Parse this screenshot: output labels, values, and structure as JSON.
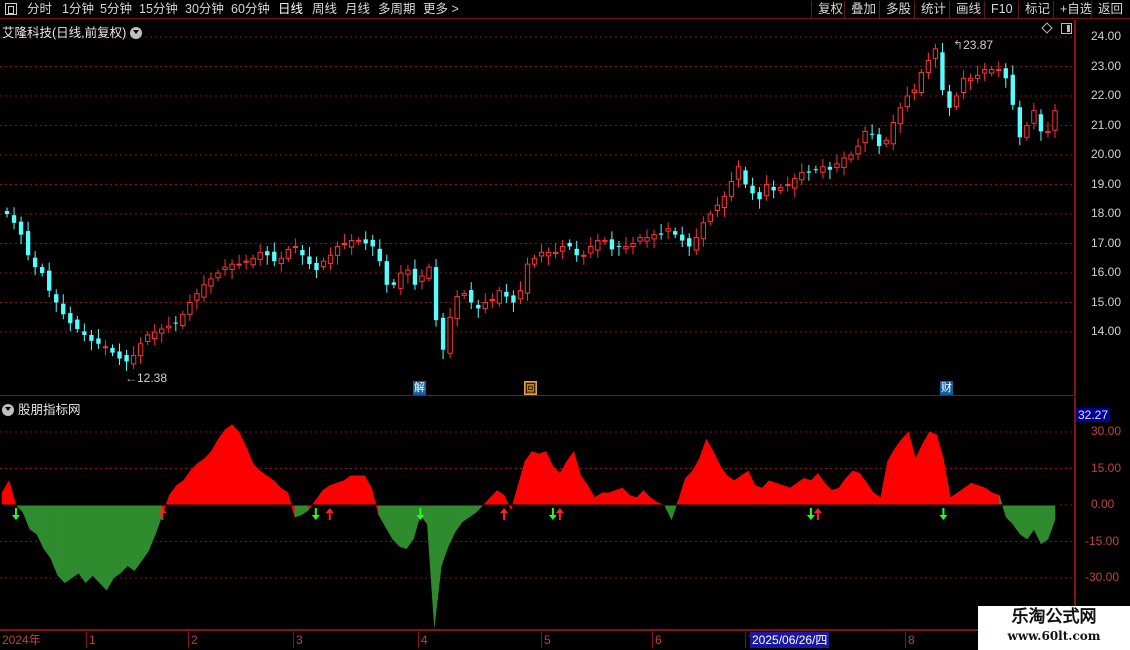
{
  "toolbar": {
    "left_items": [
      "分时",
      "1分钟",
      "5分钟",
      "15分钟",
      "30分钟",
      "60分钟",
      "日线",
      "周线",
      "月线",
      "多周期",
      "更多 >"
    ],
    "active_item": "日线",
    "right_items": [
      "复权",
      "叠加",
      "多股",
      "统计",
      "画线",
      "F10",
      "标记",
      "+自选",
      "返回"
    ]
  },
  "main_panel": {
    "title": "艾隆科技(日线,前复权)",
    "high_label": "23.87",
    "low_label": "12.38",
    "price_axis": [
      "24.00",
      "23.00",
      "22.00",
      "21.00",
      "20.00",
      "19.00",
      "18.00",
      "17.00",
      "16.00",
      "15.00",
      "14.00"
    ],
    "event_tags": [
      "解",
      "回",
      "财"
    ]
  },
  "indicator_panel": {
    "title": "股朋指标网",
    "current_value": "32.27",
    "axis": [
      "30.00",
      "15.00",
      "0.00",
      "-15.00",
      "-30.00"
    ]
  },
  "date_axis": {
    "labels": [
      "2024年",
      "1",
      "2",
      "3",
      "4",
      "5",
      "6",
      "7",
      "8"
    ],
    "cursor_date": "2025/06/26/四"
  },
  "watermark": {
    "line1": "乐淘公式网",
    "line2": "www.60lt.com"
  },
  "colors": {
    "up_candle": "#ff3232",
    "down_candle": "#54ffff",
    "indicator_positive": "#ff0000",
    "indicator_negative": "#2e8b2e",
    "grid": "#8b1010"
  },
  "chart_data": {
    "type": "candlestick",
    "price_range": [
      12.38,
      23.87
    ],
    "close_series": [
      18.0,
      17.7,
      17.3,
      16.6,
      16.2,
      16.0,
      15.4,
      15.0,
      14.6,
      14.3,
      14.1,
      13.9,
      13.7,
      13.6,
      13.5,
      13.3,
      13.1,
      13.0,
      13.2,
      13.6,
      13.9,
      14.0,
      14.1,
      14.2,
      14.3,
      14.6,
      15.0,
      15.3,
      15.6,
      15.8,
      16.0,
      16.2,
      16.3,
      16.3,
      16.4,
      16.5,
      16.7,
      16.6,
      16.4,
      16.5,
      16.8,
      16.9,
      16.6,
      16.3,
      16.1,
      16.4,
      16.6,
      16.9,
      17.0,
      17.1,
      17.1,
      17.0,
      16.9,
      16.4,
      15.6,
      15.6,
      16.0,
      16.1,
      15.6,
      15.9,
      16.2,
      14.4,
      13.4,
      14.5,
      15.2,
      15.3,
      15.0,
      14.8,
      15.0,
      15.1,
      15.4,
      15.2,
      15.0,
      15.4,
      16.3,
      16.5,
      16.7,
      16.7,
      16.7,
      16.9,
      16.9,
      16.6,
      16.6,
      16.9,
      17.1,
      17.1,
      16.8,
      16.9,
      16.9,
      17.0,
      17.2,
      17.2,
      17.3,
      17.3,
      17.5,
      17.3,
      17.1,
      16.9,
      17.2,
      17.7,
      18.0,
      18.3,
      18.6,
      19.1,
      19.6,
      19.0,
      18.7,
      18.5,
      19.0,
      18.8,
      18.9,
      19.0,
      19.2,
      19.4,
      19.4,
      19.5,
      19.6,
      19.5,
      19.7,
      19.9,
      20.0,
      20.3,
      20.8,
      20.7,
      20.3,
      20.5,
      21.1,
      21.6,
      22.0,
      22.2,
      22.8,
      23.2,
      23.6,
      22.2,
      21.6,
      22.0,
      22.6,
      22.6,
      22.7,
      22.9,
      22.9,
      22.9,
      22.6,
      21.7,
      20.6,
      21.0,
      21.5,
      20.8,
      20.8,
      21.5
    ],
    "indicator_series": [
      5,
      10,
      0,
      -3,
      -10,
      -12,
      -18,
      -22,
      -29,
      -32,
      -30,
      -28,
      -32,
      -29,
      -32,
      -35,
      -30,
      -28,
      -25,
      -27,
      -23,
      -19,
      -12,
      -4,
      4,
      8,
      10,
      14,
      17,
      19,
      22,
      27,
      31,
      33,
      30,
      24,
      17,
      14,
      12,
      10,
      7,
      5,
      -5,
      -4,
      -2,
      2,
      6,
      8,
      9,
      10,
      12,
      12,
      12,
      7,
      -4,
      -9,
      -14,
      -17,
      -18,
      -14,
      -4,
      -8,
      -50,
      -25,
      -17,
      -11,
      -7,
      -5,
      -3,
      0,
      3,
      6,
      4,
      -2,
      8,
      18,
      22,
      21,
      22,
      16,
      13,
      18,
      22,
      12,
      8,
      3,
      5,
      5,
      6,
      7,
      4,
      3,
      6,
      3,
      1,
      0,
      -6,
      2,
      11,
      14,
      19,
      27,
      22,
      16,
      12,
      10,
      12,
      14,
      8,
      7,
      10,
      9,
      8,
      7,
      9,
      11,
      10,
      13,
      9,
      6,
      7,
      11,
      14,
      13,
      9,
      5,
      3,
      18,
      23,
      27,
      30,
      19,
      25,
      30,
      29,
      19,
      3,
      5,
      7,
      9,
      8,
      7,
      5,
      4,
      -5,
      -8,
      -12,
      -14,
      -10,
      -16,
      -14,
      -6
    ],
    "indicator_range": [
      -30,
      30
    ],
    "signals_up": [
      23,
      47,
      72,
      80,
      117
    ],
    "signals_down": [
      2,
      45,
      60,
      79,
      116,
      135
    ]
  }
}
